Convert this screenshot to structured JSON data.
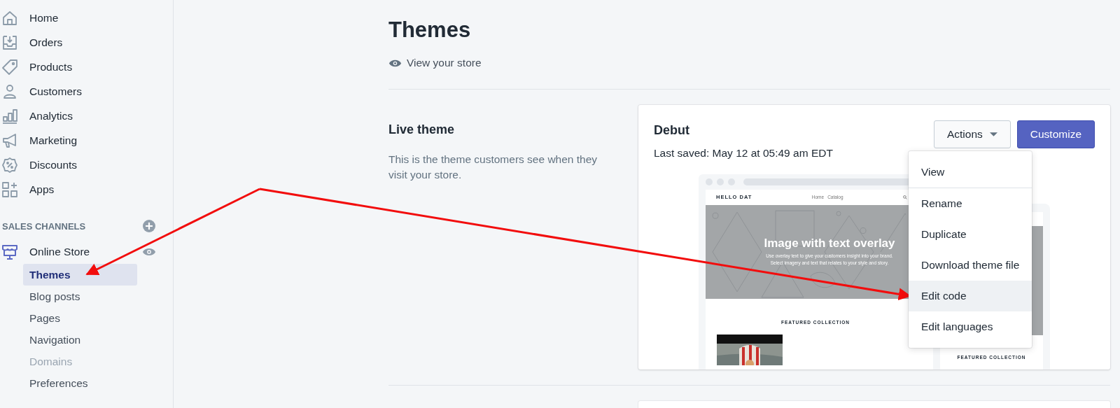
{
  "sidebar": {
    "items": [
      {
        "label": "Home"
      },
      {
        "label": "Orders"
      },
      {
        "label": "Products"
      },
      {
        "label": "Customers"
      },
      {
        "label": "Analytics"
      },
      {
        "label": "Marketing"
      },
      {
        "label": "Discounts"
      },
      {
        "label": "Apps"
      }
    ],
    "sales_channels": {
      "heading": "SALES CHANNELS",
      "channel": "Online Store",
      "subitems": [
        {
          "label": "Themes",
          "selected": true,
          "disabled": false
        },
        {
          "label": "Blog posts",
          "selected": false,
          "disabled": false
        },
        {
          "label": "Pages",
          "selected": false,
          "disabled": false
        },
        {
          "label": "Navigation",
          "selected": false,
          "disabled": false
        },
        {
          "label": "Domains",
          "selected": false,
          "disabled": true
        },
        {
          "label": "Preferences",
          "selected": false,
          "disabled": false
        }
      ]
    }
  },
  "page": {
    "title": "Themes",
    "view_link": "View your store"
  },
  "live_theme": {
    "heading": "Live theme",
    "description": "This is the theme customers see when they visit your store.",
    "card": {
      "name": "Debut",
      "last_saved": "Last saved: May 12 at 05:49 am EDT",
      "actions_button": "Actions",
      "customize_button": "Customize",
      "preview": {
        "store_name": "HELLO DAT",
        "nav": [
          "Home",
          "Catalog"
        ],
        "hero_title": "Image with text overlay",
        "hero_text": "Use overlay text to give your customers insight into your brand. Select imagery and text that relates to your style and story.",
        "featured": "FEATURED COLLECTION",
        "mobile_featured": "FEATURED COLLECTION"
      }
    }
  },
  "actions_menu": {
    "sections": [
      [
        {
          "label": "View",
          "selected": false
        }
      ],
      [
        {
          "label": "Rename",
          "selected": false
        },
        {
          "label": "Duplicate",
          "selected": false
        },
        {
          "label": "Download theme file",
          "selected": false
        },
        {
          "label": "Edit code",
          "selected": true
        },
        {
          "label": "Edit languages",
          "selected": false
        }
      ]
    ]
  }
}
